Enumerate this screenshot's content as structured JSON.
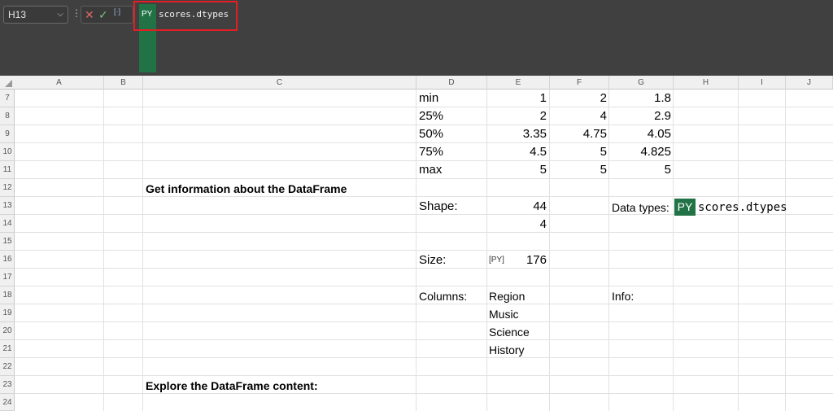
{
  "formula_bar": {
    "name_box": "H13",
    "dots": "⋮",
    "py_badge": "PY",
    "formula": "scores.dtypes",
    "cancel_icon": "✕",
    "confirm_icon": "✓",
    "insert_icon": "[·]"
  },
  "columns": [
    "A",
    "B",
    "C",
    "D",
    "E",
    "F",
    "G",
    "H",
    "I",
    "J"
  ],
  "rows": [
    "7",
    "8",
    "9",
    "10",
    "11",
    "12",
    "13",
    "14",
    "15",
    "16",
    "17",
    "18",
    "19",
    "20",
    "21",
    "22",
    "23",
    "24"
  ],
  "cells": {
    "D7": "min",
    "E7": "1",
    "F7": "2",
    "G7": "1.8",
    "D8": "25%",
    "E8": "2",
    "F8": "4",
    "G8": "2.9",
    "D9": "50%",
    "E9": "3.35",
    "F9": "4.75",
    "G9": "4.05",
    "D10": "75%",
    "E10": "4.5",
    "F10": "5",
    "G10": "4.825",
    "D11": "max",
    "E11": "5",
    "F11": "5",
    "G11": "5",
    "C12": "Get information about the DataFrame",
    "D13": "Shape:",
    "E13": "44",
    "G13": "Data types:",
    "E14": "4",
    "D16": "Size:",
    "E16": "176",
    "D18": "Columns:",
    "E18": "Region",
    "G18": "Info:",
    "E19": "Music",
    "E20": "Science",
    "E21": "History",
    "C23": "Explore the DataFrame content:"
  },
  "h13": {
    "py_badge": "PY",
    "text": "scores.dtypes"
  },
  "e16_card_icon": "[PY]"
}
